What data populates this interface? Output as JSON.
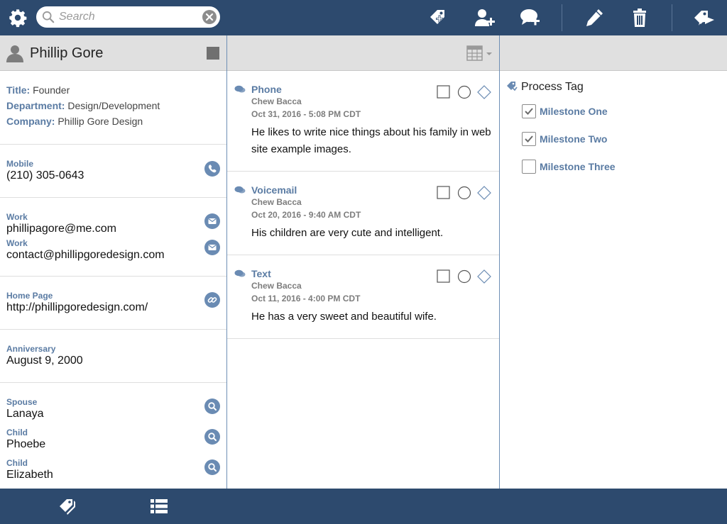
{
  "search": {
    "placeholder": "Search"
  },
  "contact": {
    "name": "Phillip Gore",
    "title_label": "Title:",
    "title": "Founder",
    "department_label": "Department:",
    "department": "Design/Development",
    "company_label": "Company:",
    "company": "Phillip Gore Design",
    "mobile_label": "Mobile",
    "mobile": "(210) 305-0643",
    "emails": [
      {
        "label": "Work",
        "value": "phillipagore@me.com"
      },
      {
        "label": "Work",
        "value": "contact@phillipgoredesign.com"
      }
    ],
    "homepage_label": "Home Page",
    "homepage": "http://phillipgoredesign.com/",
    "anniversary_label": "Anniversary",
    "anniversary": "August 9, 2000",
    "relations": [
      {
        "label": "Spouse",
        "value": "Lanaya"
      },
      {
        "label": "Child",
        "value": "Phoebe"
      },
      {
        "label": "Child",
        "value": "Elizabeth"
      }
    ]
  },
  "history": [
    {
      "type": "Phone",
      "by": "Chew Bacca",
      "date": "Oct 31, 2016 - 5:08 PM CDT",
      "note": "He likes to write nice things about his family in web site example images."
    },
    {
      "type": "Voicemail",
      "by": "Chew Bacca",
      "date": "Oct 20, 2016 - 9:40 AM CDT",
      "note": "His children are very cute and intelligent."
    },
    {
      "type": "Text",
      "by": "Chew Bacca",
      "date": "Oct 11, 2016 - 4:00 PM CDT",
      "note": "He has a very sweet and beautiful wife."
    }
  ],
  "process": {
    "label": "Process Tag",
    "milestones": [
      {
        "label": "Milestone One",
        "checked": true
      },
      {
        "label": "Milestone Two",
        "checked": true
      },
      {
        "label": "Milestone Three",
        "checked": false
      }
    ]
  },
  "colors": {
    "bar": "#2d4a6e",
    "accent": "#5a7ba3",
    "header": "#e0e0e0"
  }
}
